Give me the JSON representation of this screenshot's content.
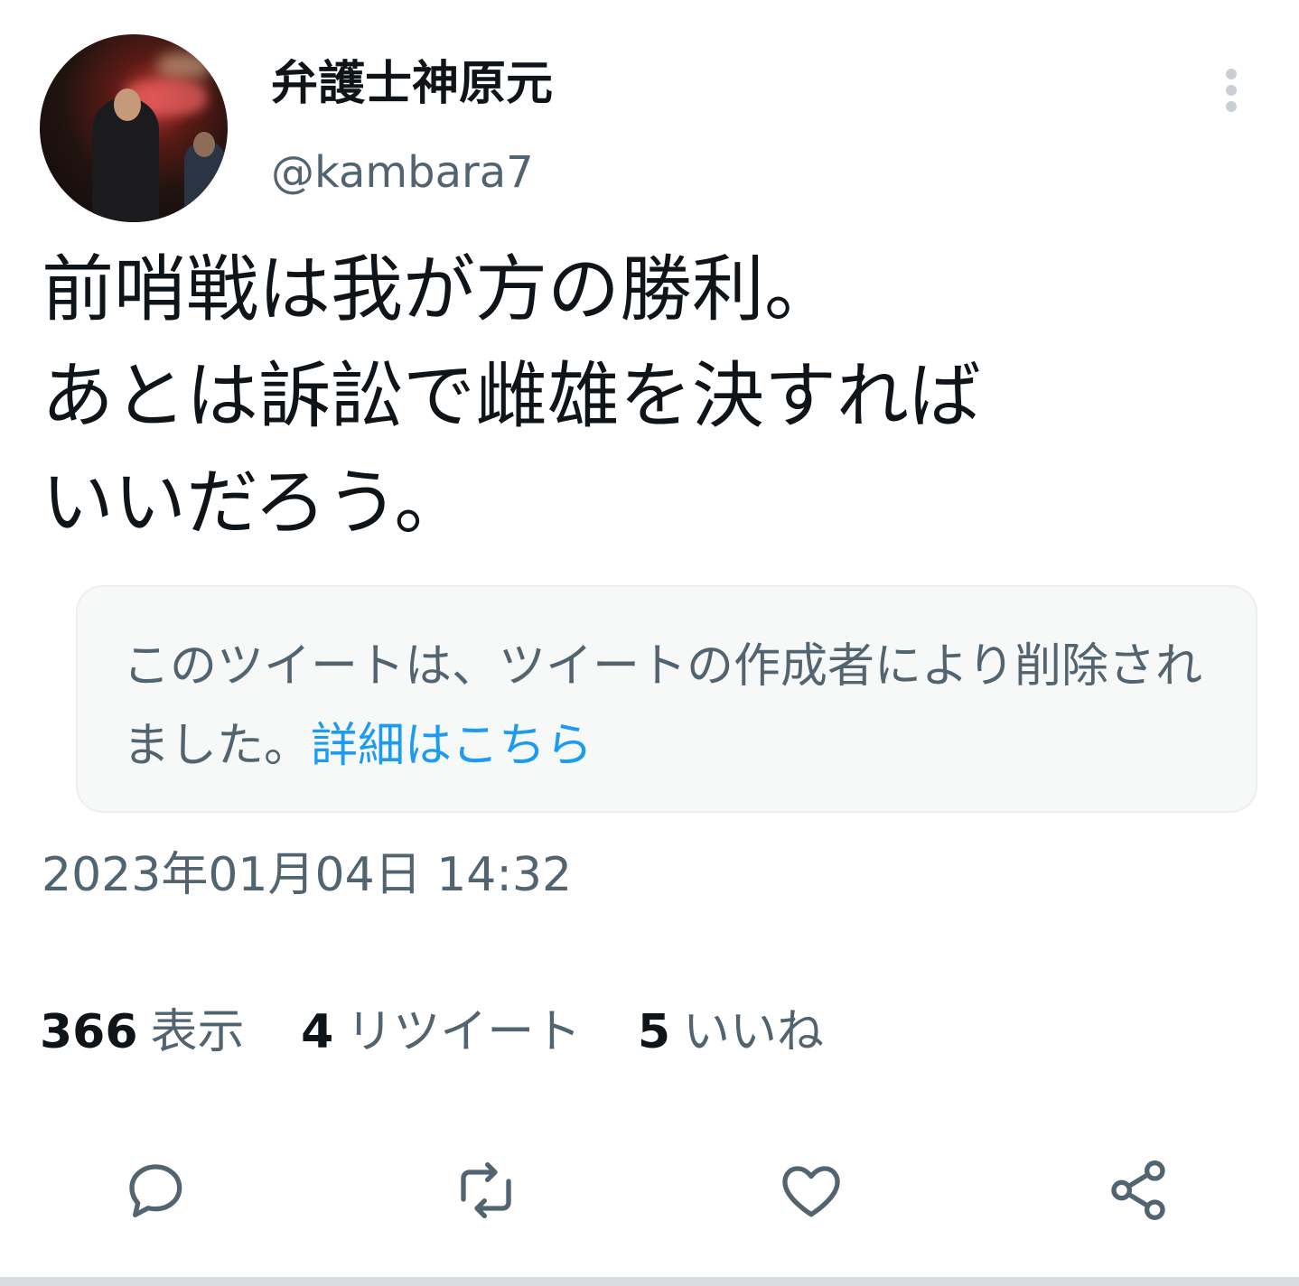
{
  "author": {
    "display_name": "弁護士神原元",
    "handle": "@kambara7"
  },
  "tweet": {
    "text": "前哨戦は我が方の勝利。\nあとは訴訟で雌雄を決すれば\nいいだろう。"
  },
  "deleted_notice": {
    "text": "このツイートは、ツイートの作成者により削除されました。",
    "link_label": "詳細はこちら",
    "link_color": "#1d9bf0"
  },
  "timestamp": "2023年01月04日 14:32",
  "stats": [
    {
      "count": "366",
      "label": "表示"
    },
    {
      "count": "4",
      "label": "リツイート"
    },
    {
      "count": "5",
      "label": "いいね"
    }
  ],
  "actions": {
    "reply_icon": "reply-icon",
    "retweet_icon": "retweet-icon",
    "like_icon": "heart-icon",
    "share_icon": "share-icon"
  },
  "colors": {
    "text_primary": "#0f1419",
    "text_secondary": "#536471",
    "notice_bg": "#f7f9f9"
  }
}
